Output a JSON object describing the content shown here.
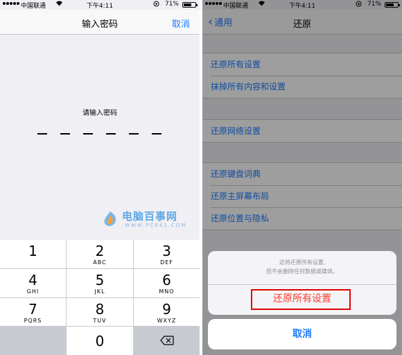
{
  "status": {
    "carrier": "中国联通",
    "time": "下午4:11",
    "battery_pct": "71%",
    "battery_level": 0.71
  },
  "left": {
    "nav_title": "输入密码",
    "cancel_label": "取消",
    "prompt": "请输入密码",
    "keys": [
      {
        "digit": "1",
        "letters": ""
      },
      {
        "digit": "2",
        "letters": "ABC"
      },
      {
        "digit": "3",
        "letters": "DEF"
      },
      {
        "digit": "4",
        "letters": "GHI"
      },
      {
        "digit": "5",
        "letters": "JKL"
      },
      {
        "digit": "6",
        "letters": "MNO"
      },
      {
        "digit": "7",
        "letters": "PQRS"
      },
      {
        "digit": "8",
        "letters": "TUV"
      },
      {
        "digit": "9",
        "letters": "WXYZ"
      },
      {
        "digit": "0",
        "letters": ""
      }
    ],
    "watermark": {
      "title": "电脑百事网",
      "url": "WWW.PC841.COM"
    }
  },
  "right": {
    "back_label": "通用",
    "nav_title": "还原",
    "groups": [
      [
        "还原所有设置",
        "抹掉所有内容和设置"
      ],
      [
        "还原网络设置"
      ],
      [
        "还原键盘词典",
        "还原主屏幕布局",
        "还原位置与隐私"
      ]
    ],
    "sheet": {
      "message_line1": "这将还原所有设置,",
      "message_line2": "但不会删除任何数据或媒体。",
      "reset_label": "还原所有设置",
      "cancel_label": "取消"
    }
  },
  "colors": {
    "accent": "#1a7bff",
    "destructive": "#fe3b30",
    "highlight": "#e00000"
  }
}
